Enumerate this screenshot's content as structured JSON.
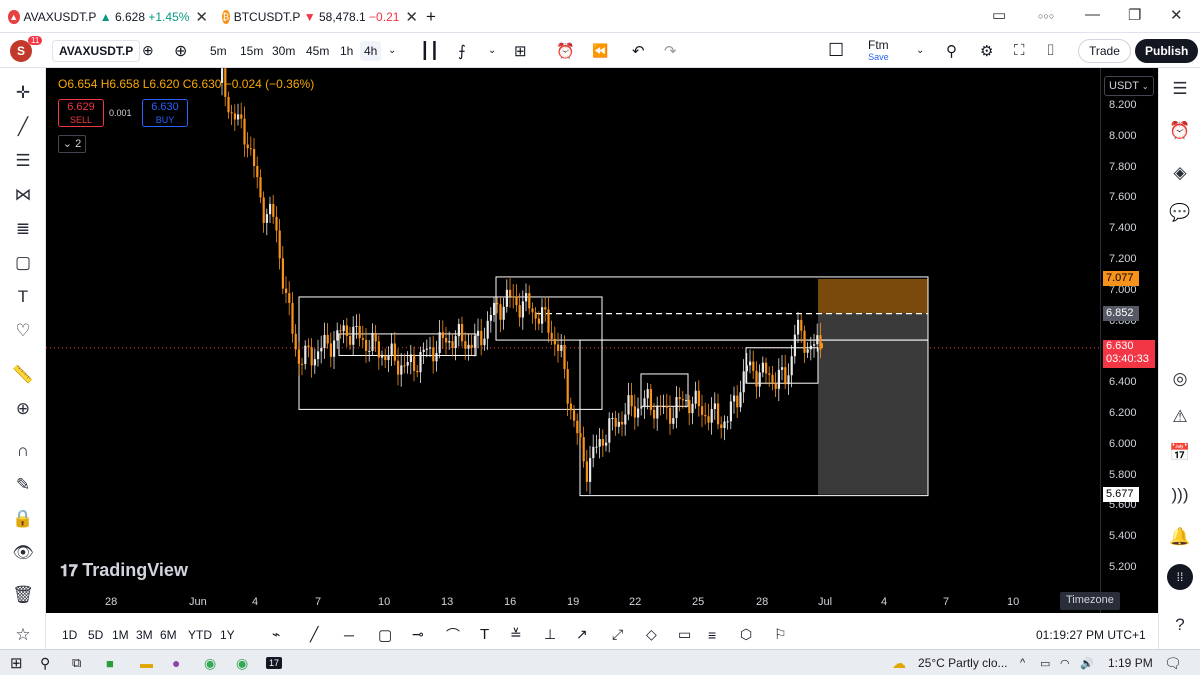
{
  "tabs": [
    {
      "symbol": "AVAXUSDT.P",
      "arrow": "▲",
      "price": "6.628",
      "change": "+1.45%",
      "direction": "up"
    },
    {
      "symbol": "BTCUSDT.P",
      "arrow": "▼",
      "price": "58,478.1",
      "change": "−0.21",
      "direction": "down"
    }
  ],
  "new_tab_icon": "+",
  "window": {
    "more": "○○○",
    "minimize": "—",
    "restore": "❐",
    "close": "✕"
  },
  "toolbar": {
    "avatar_letter": "S",
    "notif_count": "11",
    "symbol": "AVAXUSDT.P",
    "intervals": [
      "5m",
      "15m",
      "30m",
      "45m",
      "1h",
      "4h"
    ],
    "active_interval": "4h",
    "layout_name": "Ftm",
    "layout_sub": "Save",
    "trade_label": "Trade",
    "publish_label": "Publish"
  },
  "legend": {
    "ohlc": "O6.654 H6.658 L6.620 C6.630 −0.024 (−0.36%)",
    "sell_price": "6.629",
    "sell_label": "SELL",
    "spread": "0.001",
    "buy_price": "6.630",
    "buy_label": "BUY",
    "collapse_label": "2"
  },
  "watermark": "TradingView",
  "price_axis": {
    "currency": "USDT",
    "labels": [
      "8.200",
      "8.000",
      "7.800",
      "7.600",
      "7.400",
      "7.200",
      "7.000",
      "6.800",
      "6.400",
      "6.200",
      "6.000",
      "5.800",
      "5.600",
      "5.400",
      "5.200"
    ],
    "badges": {
      "top": "7.077",
      "mid": "6.852",
      "last": "6.630",
      "countdown": "03:40:33",
      "low": "5.677"
    }
  },
  "time_axis": {
    "labels": [
      "28",
      "Jun",
      "4",
      "7",
      "10",
      "13",
      "16",
      "19",
      "22",
      "25",
      "28",
      "Jul",
      "4",
      "7",
      "10"
    ],
    "timezone_label": "Timezone"
  },
  "bottom": {
    "ranges": [
      "1D",
      "5D",
      "1M",
      "3M",
      "6M",
      "YTD",
      "1Y"
    ],
    "clock": "01:19:27 PM UTC+1"
  },
  "taskbar": {
    "weather": "25°C  Partly clo...",
    "time": "1:19 PM"
  },
  "colors": {
    "up_candle": "#e8e8e8",
    "down_candle": "#f7931a",
    "box_border": "#ffffff",
    "target_zone": "#7a4a0d",
    "stop_zone": "#3a3a3a",
    "last_price": "#f23645"
  },
  "chart_data": {
    "type": "candlestick",
    "symbol": "AVAXUSDT.P",
    "interval": "4h",
    "ylim": [
      5.1,
      8.3
    ],
    "x_ticks": [
      "28",
      "Jun",
      "4",
      "7",
      "10",
      "13",
      "16",
      "19",
      "22",
      "25",
      "28",
      "Jul",
      "4",
      "7",
      "10"
    ],
    "last_close": 6.63,
    "levels": {
      "target": 7.077,
      "entry": 6.852,
      "stop": 5.677
    }
  }
}
